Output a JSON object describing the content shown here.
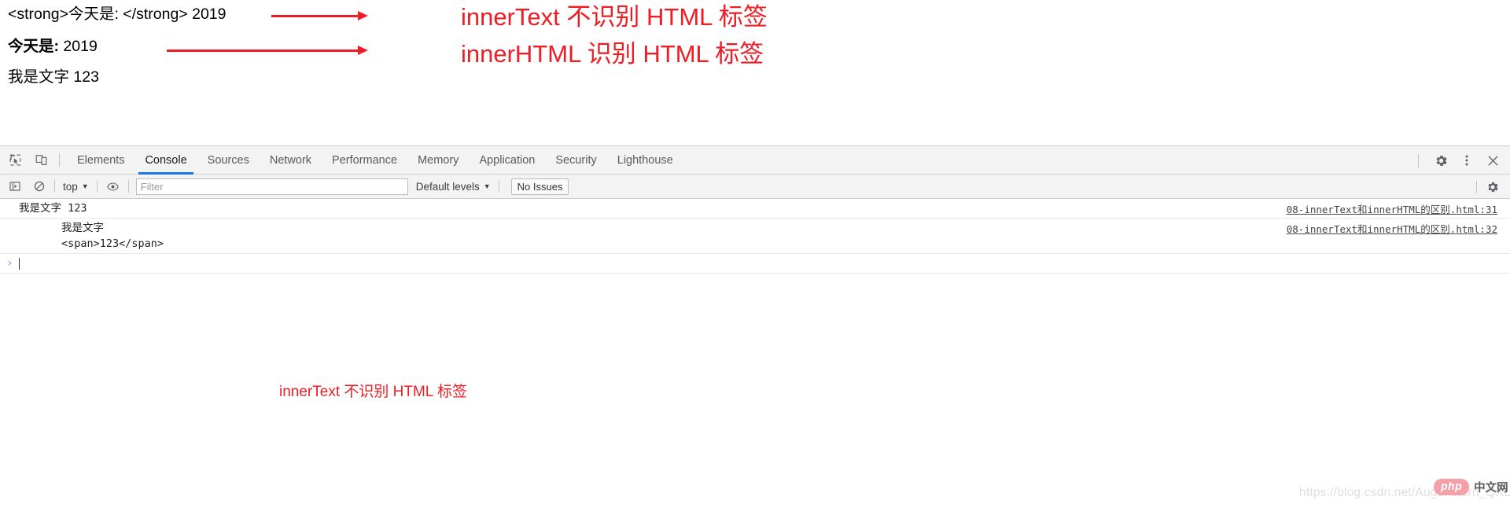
{
  "page": {
    "line1": "<strong>今天是: </strong> 2019",
    "line2_bold": "今天是:",
    "line2_rest": " 2019",
    "line3": "我是文字 123"
  },
  "annotations": {
    "innertext_note": "innerText 不识别 HTML 标签",
    "innerhtml_note": "innerHTML 识别 HTML 标签",
    "console_note": "innerText 不识别 HTML 标签",
    "arrow_icon": "right-arrow-icon",
    "accent_color": "#ee1c25"
  },
  "devtools": {
    "inspect_icon": "inspect-element-icon",
    "device_toolbar_icon": "device-toolbar-icon",
    "tabs": [
      {
        "label": "Elements",
        "active": false
      },
      {
        "label": "Console",
        "active": true
      },
      {
        "label": "Sources",
        "active": false
      },
      {
        "label": "Network",
        "active": false
      },
      {
        "label": "Performance",
        "active": false
      },
      {
        "label": "Memory",
        "active": false
      },
      {
        "label": "Application",
        "active": false
      },
      {
        "label": "Security",
        "active": false
      },
      {
        "label": "Lighthouse",
        "active": false
      }
    ],
    "active_tab_underline_color": "#1a73e8",
    "toolbar_right": {
      "settings_icon": "gear-icon",
      "more_icon": "kebab-menu-icon",
      "close_icon": "close-icon"
    },
    "filterbar": {
      "sidebar_toggle_icon": "console-sidebar-icon",
      "clear_console_icon": "clear-console-icon",
      "context_label": "top",
      "context_caret": "▼",
      "eye_icon": "eye-icon",
      "filter_placeholder": "Filter",
      "filter_value": "",
      "levels_label": "Default levels",
      "levels_caret": "▼",
      "issues_label": "No Issues",
      "settings_icon": "gear-icon"
    },
    "console": {
      "messages": [
        {
          "text": "我是文字 123",
          "indent": false,
          "link": "08-innerText和innerHTML的区别.html:31"
        },
        {
          "text": "我是文字\n<span>123</span>",
          "indent": true,
          "link": "08-innerText和innerHTML的区别.html:32"
        }
      ],
      "prompt_arrow": "›"
    }
  },
  "watermark": {
    "url": "https://blog.csdn.net/Augenstern_QXL",
    "logo_php": "php",
    "logo_cn": "中文网"
  }
}
